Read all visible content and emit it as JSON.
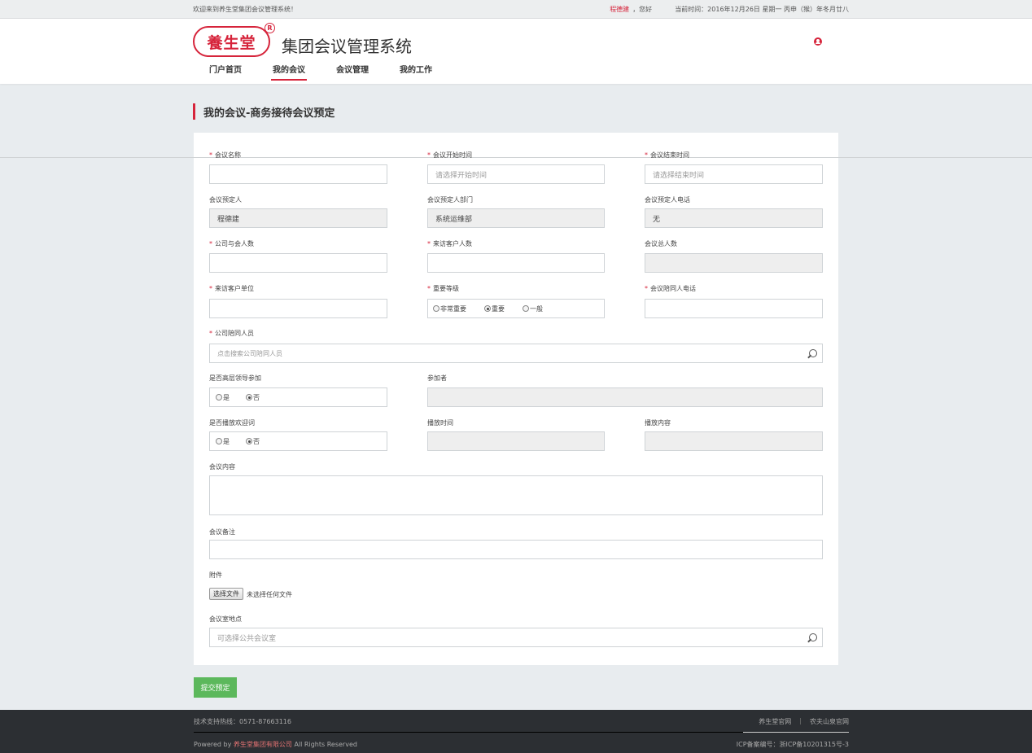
{
  "topbar": {
    "welcome": "欢迎来到养生堂集团会议管理系统！",
    "user_name": "程德建",
    "greeting": "，您好",
    "time": "当前时间：2016年12月26日  星期一  丙申（猴）年冬月廿八"
  },
  "header": {
    "logo_text": "養生堂",
    "reg_mark": "R",
    "system_title": "集团会议管理系统",
    "nav": [
      "门户首页",
      "我的会议",
      "会议管理",
      "我的工作"
    ],
    "nav_active": 1
  },
  "page": {
    "section_title": "我的会议-商务接待会议预定"
  },
  "form": {
    "meeting_name": {
      "label": "会议名称",
      "required": "*",
      "value": ""
    },
    "start_time": {
      "label": "会议开始时间",
      "required": "*",
      "placeholder": "请选择开始时间"
    },
    "end_time": {
      "label": "会议结束时间",
      "required": "*",
      "placeholder": "请选择结束时间"
    },
    "booker": {
      "label": "会议预定人",
      "value": "程德建"
    },
    "booker_dept": {
      "label": "会议预定人部门",
      "value": "系统运维部"
    },
    "booker_phone": {
      "label": "会议预定人电话",
      "value": "无"
    },
    "company_attendees": {
      "label": "公司与会人数",
      "required": "*"
    },
    "visitor_count": {
      "label": "来访客户人数",
      "required": "*"
    },
    "total_count": {
      "label": "会议总人数"
    },
    "visitor_unit": {
      "label": "来访客户单位",
      "required": "*"
    },
    "importance": {
      "label": "重要等级",
      "required": "*",
      "options": [
        "非常重要",
        "重要",
        "一般"
      ],
      "selected": 1
    },
    "escort_phone": {
      "label": "会议陪同人电话",
      "required": "*"
    },
    "company_escort": {
      "label": "公司陪同人员",
      "required": "*",
      "placeholder": "点击搜索公司陪同人员"
    },
    "senior_leader": {
      "label": "是否高层领导参加",
      "options": [
        "是",
        "否"
      ],
      "selected": 1
    },
    "participants": {
      "label": "参加者"
    },
    "welcome_speech": {
      "label": "是否播放欢迎词",
      "options": [
        "是",
        "否"
      ],
      "selected": 1
    },
    "play_time": {
      "label": "播放时间"
    },
    "play_content": {
      "label": "播放内容"
    },
    "meeting_content": {
      "label": "会议内容"
    },
    "meeting_note": {
      "label": "会议备注"
    },
    "attachment": {
      "label": "附件",
      "button": "选择文件",
      "status": "未选择任何文件"
    },
    "room": {
      "label": "会议室地点",
      "placeholder": "可选择公共会议室"
    }
  },
  "submit_label": "提交预定",
  "footer": {
    "hotline": "技术支持热线：0571-87663116",
    "powered_prefix": "Powered by ",
    "company": "养生堂集团有限公司",
    "powered_suffix": " All Rights Reserved",
    "links": [
      "养生堂官网",
      "农夫山泉官网"
    ],
    "link_separator": "|",
    "icp": "ICP备案编号：浙ICP备10201315号-3"
  },
  "colors": {
    "accent": "#d6243b",
    "submit": "#5cb85c",
    "footer_bg": "#2c2f33"
  }
}
